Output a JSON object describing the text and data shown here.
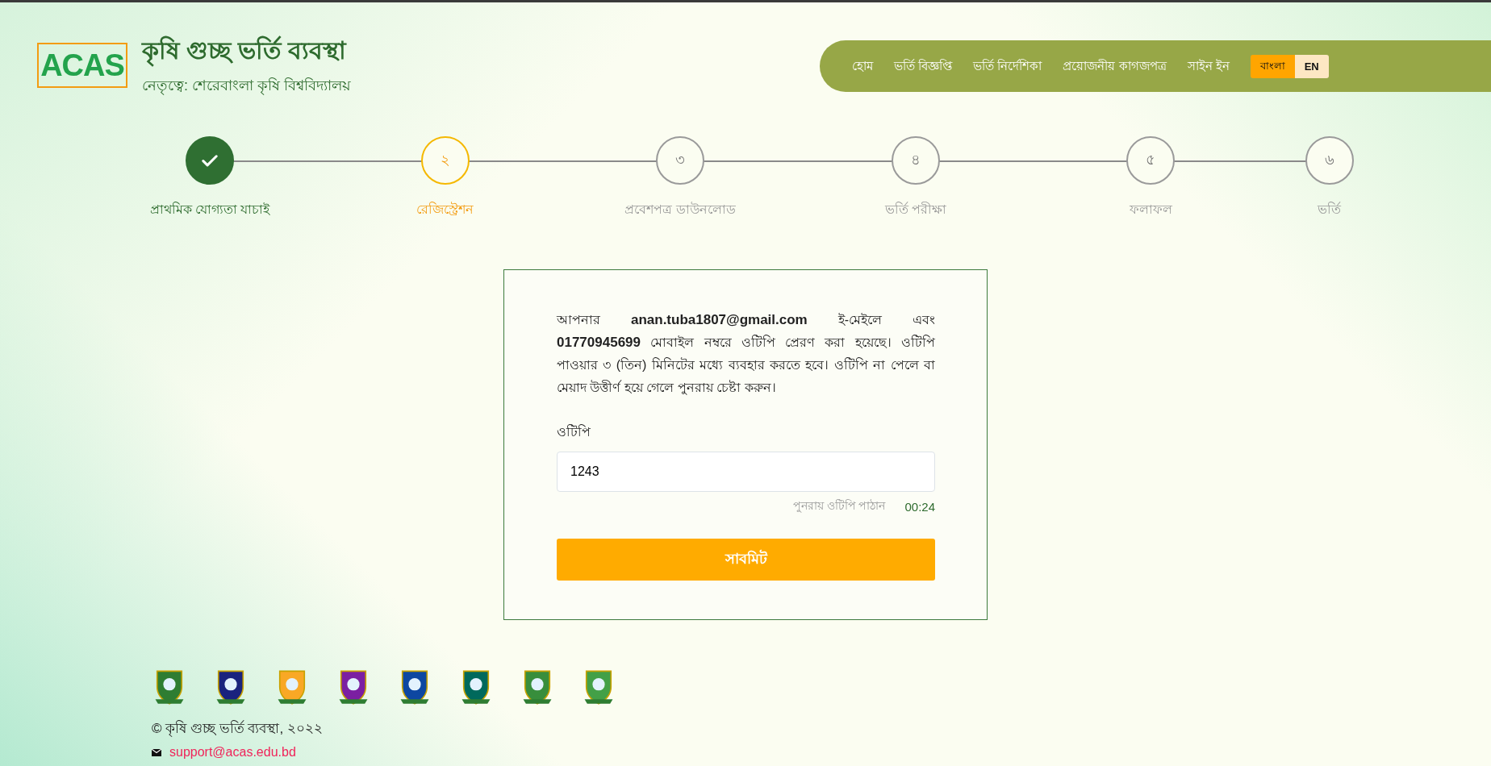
{
  "header": {
    "logo_text": "ACAS",
    "title": "কৃষি গুচ্ছ ভর্তি ব্যবস্থা",
    "subtitle": "নেতৃত্বে: শেরেবাংলা কৃষি বিশ্ববিদ্যালয়"
  },
  "nav": {
    "items": [
      "হোম",
      "ভর্তি বিজ্ঞপ্তি",
      "ভর্তি নির্দেশিকা",
      "প্রয়োজনীয় কাগজপত্র",
      "সাইন ইন"
    ],
    "languages": [
      {
        "label": "বাংলা",
        "selected": true
      },
      {
        "label": "EN",
        "selected": false
      }
    ]
  },
  "steps": [
    {
      "label": "প্রাথমিক যোগ্যতা যাচাই",
      "kind": "done"
    },
    {
      "marker": "২",
      "label": "রেজিস্ট্রেশন",
      "kind": "current"
    },
    {
      "marker": "৩",
      "label": "প্রবেশপত্র ডাউনলোড",
      "kind": "pending"
    },
    {
      "marker": "৪",
      "label": "ভর্তি পরীক্ষা",
      "kind": "pending"
    },
    {
      "marker": "৫",
      "label": "ফলাফল",
      "kind": "pending"
    },
    {
      "marker": "৬",
      "label": "ভর্তি",
      "kind": "pending"
    }
  ],
  "otp_card": {
    "message": "আপনার **anan.tuba1807@gmail.com** ই-মেইলে এবং **01770945699** মোবাইল নম্বরে ওটিপি প্রেরণ করা হয়েছে। ওটিপি পাওয়ার ৩ (তিন) মিনিটের মধ্যে ব্যবহার করতে হবে। ওটিপি না পেলে বা মেয়াদ উত্তীর্ণ হয়ে গেলে পুনরায় চেষ্টা করুন।",
    "field_label": "ওটিপি",
    "field_value": "1243",
    "resend": "পুনরায় ওটিপি পাঠান",
    "timer": "00:24",
    "submit": "সাবমিট"
  },
  "footer": {
    "copyright": "© কৃষি গুচ্ছ ভর্তি ব্যবস্থা, ২০২২",
    "email": "support@acas.edu.bd"
  }
}
